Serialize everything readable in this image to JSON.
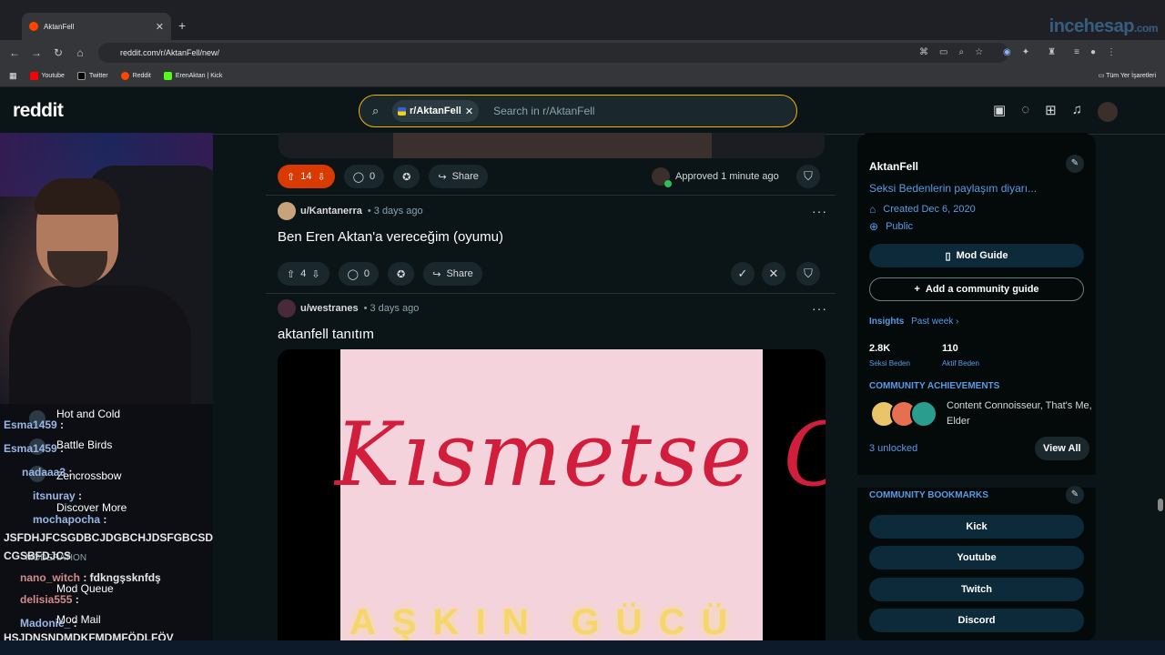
{
  "browser": {
    "tab_title": "AktanFell",
    "url": "reddit.com/r/AktanFell/new/",
    "bookmarks": [
      "Youtube",
      "Twitter",
      "Reddit",
      "ErenAktan | Kick"
    ],
    "all_bookmarks": "Tüm Yer İşaretleri",
    "watermark": "incehesap.com"
  },
  "reddit": {
    "logo": "reddit",
    "search_chip": "r/AktanFell",
    "search_placeholder": "Search in r/AktanFell"
  },
  "posts": [
    {
      "upvotes": "14",
      "comments": "0",
      "share": "Share",
      "approved": "Approved 1 minute ago"
    },
    {
      "author": "u/Kantanerra",
      "time": "• 3 days ago",
      "title": "Ben Eren Aktan'a vereceğim (oyumu)",
      "upvotes": "4",
      "comments": "0",
      "share": "Share"
    },
    {
      "author": "u/westranes",
      "time": "• 3 days ago",
      "title": "aktanfell tanıtım",
      "video_text_1": "Kısmetse Olu",
      "video_text_2": "AŞKIN GÜCÜ"
    }
  ],
  "sidebar": {
    "name": "AktanFell",
    "description": "Seksi Bedenlerin paylaşım diyarı...",
    "created": "Created Dec 6, 2020",
    "visibility": "Public",
    "mod_guide": "Mod Guide",
    "add_guide": "Add a community guide",
    "insights": "Insights",
    "insights_period": "Past week ›",
    "members": "2.8K",
    "members_label": "Seksi Beden",
    "online": "110",
    "online_label": "Aktif Beden",
    "achievements_title": "COMMUNITY ACHIEVEMENTS",
    "achievements": "Content Connoisseur, That's Me, Elder",
    "unlocked": "3 unlocked",
    "view_all": "View All",
    "bookmarks_title": "COMMUNITY BOOKMARKS",
    "bookmark_links": [
      "Kick",
      "Youtube",
      "Twitch",
      "Discord"
    ]
  },
  "stream": {
    "chat": [
      {
        "user": "Esma1459",
        "text": " :"
      },
      {
        "user": "Esma1459",
        "text": " :"
      },
      {
        "user": "nadaaa3",
        "text": " :"
      },
      {
        "user": "itsnuray",
        "text": " :"
      },
      {
        "user": "mochapocha",
        "text": " :"
      },
      {
        "user": "",
        "text": "JSFDHJFCSGDBCJDGBCHJDSFGBCSDJH"
      },
      {
        "user": "",
        "text": "CGSBFDJCS"
      },
      {
        "user": "nano_witch",
        "text": " : fdkngşsknfdş"
      },
      {
        "user": "delisia555",
        "text": " :"
      },
      {
        "user": "Madonie_",
        "text": " :"
      },
      {
        "user": "",
        "text": "HSJDNSNDMDKFMDMFÖDLFÖV"
      }
    ],
    "menu": [
      "Hot and Cold",
      "Battle Birds",
      "Zencrossbow",
      "Discover More",
      "MODERATION",
      "Mod Queue",
      "Mod Mail"
    ]
  },
  "colors": {
    "accent": "#f5b301",
    "upvote": "#d93a00",
    "link": "#5b9be6"
  }
}
